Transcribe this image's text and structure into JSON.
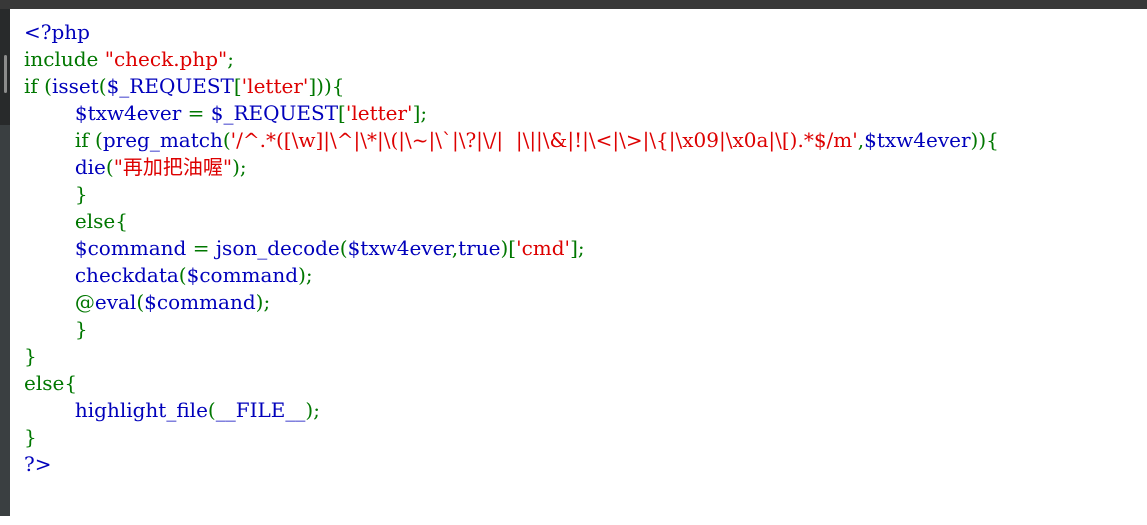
{
  "window": {
    "title": "PHP source view",
    "background_color": "#ffffff",
    "chrome_color": "#383838",
    "gutter_color": "#3a3f41",
    "gutter_upper_color": "#282a2b",
    "scrollbar_thumb_color": "#8c8c8c"
  },
  "palette": {
    "default": "#0000BB",
    "keyword": "#007700",
    "string": "#DD0000",
    "comment": "#FF8000",
    "html": "#000000"
  },
  "code": {
    "language": "php",
    "renderer": "highlight_file",
    "lines": [
      {
        "n": 1,
        "tokens": [
          {
            "t": "default",
            "s": "<?php"
          }
        ]
      },
      {
        "n": 2,
        "tokens": [
          {
            "t": "keyword",
            "s": "include "
          },
          {
            "t": "string",
            "s": "\"check.php\""
          },
          {
            "t": "keyword",
            "s": ";"
          }
        ]
      },
      {
        "n": 3,
        "tokens": [
          {
            "t": "keyword",
            "s": "if "
          },
          {
            "t": "keyword",
            "s": "("
          },
          {
            "t": "default",
            "s": "isset"
          },
          {
            "t": "keyword",
            "s": "("
          },
          {
            "t": "default",
            "s": "$_REQUEST"
          },
          {
            "t": "keyword",
            "s": "["
          },
          {
            "t": "string",
            "s": "'letter'"
          },
          {
            "t": "keyword",
            "s": "])){"
          }
        ]
      },
      {
        "n": 4,
        "indent": 2,
        "tokens": [
          {
            "t": "default",
            "s": "$txw4ever "
          },
          {
            "t": "keyword",
            "s": "= "
          },
          {
            "t": "default",
            "s": "$_REQUEST"
          },
          {
            "t": "keyword",
            "s": "["
          },
          {
            "t": "string",
            "s": "'letter'"
          },
          {
            "t": "keyword",
            "s": "];"
          }
        ]
      },
      {
        "n": 5,
        "indent": 2,
        "tokens": [
          {
            "t": "keyword",
            "s": "if "
          },
          {
            "t": "keyword",
            "s": "("
          },
          {
            "t": "default",
            "s": "preg_match"
          },
          {
            "t": "keyword",
            "s": "("
          },
          {
            "t": "string",
            "s": "'/^.*([\\w]|\\^|\\*|\\(|\\~|\\`|\\?|\\/|  |\\||\\&|!|\\<|\\>|\\{|\\x09|\\x0a|\\[).*$/m'"
          },
          {
            "t": "keyword",
            "s": ","
          },
          {
            "t": "default",
            "s": "$txw4ever"
          },
          {
            "t": "keyword",
            "s": ")){"
          }
        ]
      },
      {
        "n": 6,
        "indent": 3,
        "tokens": [
          {
            "t": "default",
            "s": "die"
          },
          {
            "t": "keyword",
            "s": "("
          },
          {
            "t": "string",
            "s": "\"再加把油喔\""
          },
          {
            "t": "keyword",
            "s": ");"
          }
        ]
      },
      {
        "n": 7,
        "indent": 2,
        "tokens": [
          {
            "t": "keyword",
            "s": "}"
          }
        ]
      },
      {
        "n": 8,
        "indent": 2,
        "tokens": [
          {
            "t": "keyword",
            "s": "else{"
          }
        ]
      },
      {
        "n": 9,
        "indent": 3,
        "tokens": [
          {
            "t": "default",
            "s": "$command "
          },
          {
            "t": "keyword",
            "s": "= "
          },
          {
            "t": "default",
            "s": "json_decode"
          },
          {
            "t": "keyword",
            "s": "("
          },
          {
            "t": "default",
            "s": "$txw4ever"
          },
          {
            "t": "keyword",
            "s": ","
          },
          {
            "t": "default",
            "s": "true"
          },
          {
            "t": "keyword",
            "s": ")["
          },
          {
            "t": "string",
            "s": "'cmd'"
          },
          {
            "t": "keyword",
            "s": "];"
          }
        ]
      },
      {
        "n": 10,
        "indent": 3,
        "tokens": [
          {
            "t": "default",
            "s": "checkdata"
          },
          {
            "t": "keyword",
            "s": "("
          },
          {
            "t": "default",
            "s": "$command"
          },
          {
            "t": "keyword",
            "s": ");"
          }
        ]
      },
      {
        "n": 11,
        "indent": 3,
        "tokens": [
          {
            "t": "keyword",
            "s": "@"
          },
          {
            "t": "default",
            "s": "eval"
          },
          {
            "t": "keyword",
            "s": "("
          },
          {
            "t": "default",
            "s": "$command"
          },
          {
            "t": "keyword",
            "s": ");"
          }
        ]
      },
      {
        "n": 12,
        "indent": 2,
        "tokens": [
          {
            "t": "keyword",
            "s": "}"
          }
        ]
      },
      {
        "n": 13,
        "indent": 0,
        "tokens": [
          {
            "t": "keyword",
            "s": "}"
          }
        ]
      },
      {
        "n": 14,
        "indent": 0,
        "tokens": [
          {
            "t": "keyword",
            "s": "else{"
          }
        ]
      },
      {
        "n": 15,
        "indent": 2,
        "tokens": [
          {
            "t": "default",
            "s": "highlight_file"
          },
          {
            "t": "keyword",
            "s": "("
          },
          {
            "t": "default",
            "s": "__FILE__"
          },
          {
            "t": "keyword",
            "s": ");"
          }
        ]
      },
      {
        "n": 16,
        "indent": 0,
        "tokens": [
          {
            "t": "keyword",
            "s": "}"
          }
        ]
      },
      {
        "n": 17,
        "indent": 0,
        "tokens": [
          {
            "t": "default",
            "s": "?>"
          }
        ]
      }
    ]
  }
}
